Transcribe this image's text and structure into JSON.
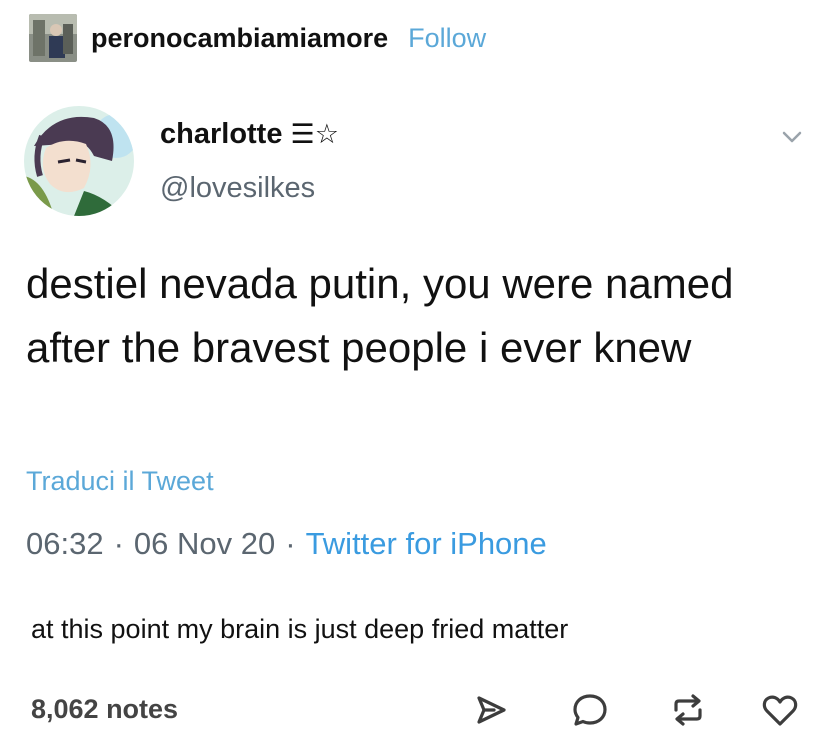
{
  "post": {
    "username": "peronocambiamiamore",
    "follow_label": "Follow",
    "avatar_icon": "blog-avatar"
  },
  "tweet": {
    "display_name": "charlotte",
    "name_decoration": "☰☆",
    "handle": "@lovesilkes",
    "avatar_icon": "user-avatar",
    "text": "destiel nevada putin, you were named after the bravest people i ever knew",
    "translate_label": "Traduci il Tweet",
    "time": "06:32",
    "date": "06 Nov 20",
    "separator": "·",
    "source": "Twitter for iPhone"
  },
  "caption": "at this point my brain is just deep fried matter",
  "footer": {
    "notes": "8,062 notes",
    "actions": [
      "share-icon",
      "reply-icon",
      "reblog-icon",
      "like-icon"
    ]
  },
  "colors": {
    "link": "#5ba8d8",
    "source_link": "#3a9be0",
    "muted": "#5b6670",
    "text": "#111111"
  }
}
